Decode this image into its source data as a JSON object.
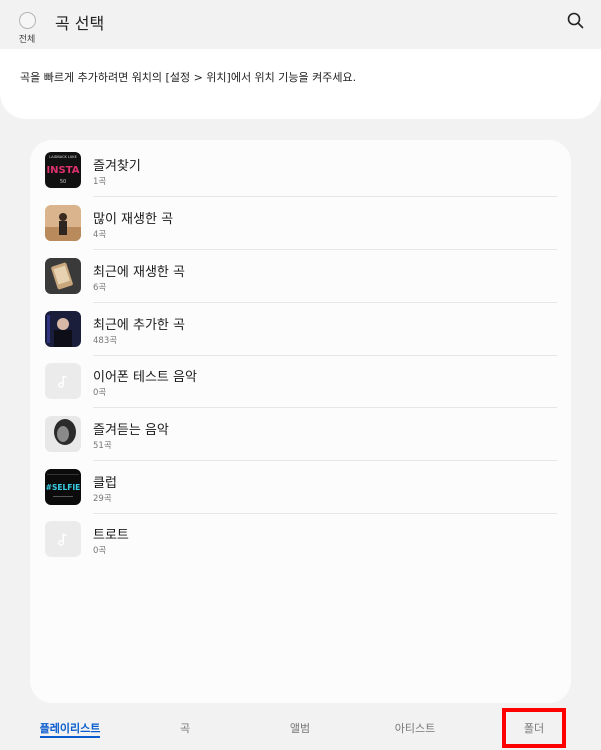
{
  "header": {
    "select_all_label": "전체",
    "title": "곡 선택",
    "search_icon": "search-icon"
  },
  "notice": {
    "text": "곡을 빠르게 추가하려면 워치의 [설정 > 위치]에서 위치 기능을 켜주세요."
  },
  "playlists": [
    {
      "name": "즐겨찾기",
      "count": "1곡",
      "thumb": "album-art-1"
    },
    {
      "name": "많이 재생한 곡",
      "count": "4곡",
      "thumb": "album-art-2"
    },
    {
      "name": "최근에 재생한 곡",
      "count": "6곡",
      "thumb": "album-art-3"
    },
    {
      "name": "최근에 추가한 곡",
      "count": "483곡",
      "thumb": "album-art-4"
    },
    {
      "name": "이어폰 테스트 음악",
      "count": "0곡",
      "thumb": "music-note-icon"
    },
    {
      "name": "즐겨듣는 음악",
      "count": "51곡",
      "thumb": "album-art-5"
    },
    {
      "name": "클럽",
      "count": "29곡",
      "thumb": "album-art-6"
    },
    {
      "name": "트로트",
      "count": "0곡",
      "thumb": "music-note-icon"
    }
  ],
  "thumb_text": {
    "art1_top": "LAIDBACK LUKE",
    "art1_main": "INSTA",
    "art1_sub": "50",
    "art6_main": "#SELFIE"
  },
  "tabs": [
    {
      "label": "플레이리스트",
      "active": true
    },
    {
      "label": "곡",
      "active": false
    },
    {
      "label": "앨범",
      "active": false
    },
    {
      "label": "아티스트",
      "active": false
    },
    {
      "label": "폴더",
      "active": false
    }
  ],
  "colors": {
    "accent": "#0a5ccf",
    "highlight": "#ff0000",
    "background": "#f2f2f2"
  }
}
